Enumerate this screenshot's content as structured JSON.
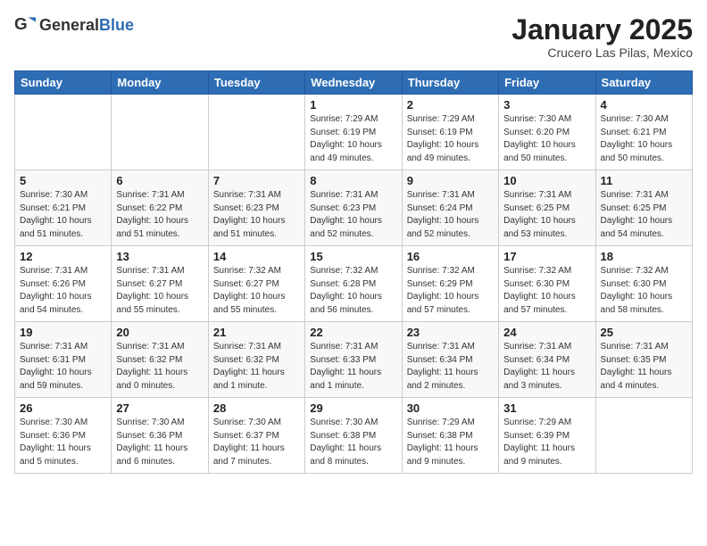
{
  "header": {
    "logo_general": "General",
    "logo_blue": "Blue",
    "month_year": "January 2025",
    "location": "Crucero Las Pilas, Mexico"
  },
  "weekdays": [
    "Sunday",
    "Monday",
    "Tuesday",
    "Wednesday",
    "Thursday",
    "Friday",
    "Saturday"
  ],
  "weeks": [
    [
      {
        "day": "",
        "content": ""
      },
      {
        "day": "",
        "content": ""
      },
      {
        "day": "",
        "content": ""
      },
      {
        "day": "1",
        "content": "Sunrise: 7:29 AM\nSunset: 6:19 PM\nDaylight: 10 hours\nand 49 minutes."
      },
      {
        "day": "2",
        "content": "Sunrise: 7:29 AM\nSunset: 6:19 PM\nDaylight: 10 hours\nand 49 minutes."
      },
      {
        "day": "3",
        "content": "Sunrise: 7:30 AM\nSunset: 6:20 PM\nDaylight: 10 hours\nand 50 minutes."
      },
      {
        "day": "4",
        "content": "Sunrise: 7:30 AM\nSunset: 6:21 PM\nDaylight: 10 hours\nand 50 minutes."
      }
    ],
    [
      {
        "day": "5",
        "content": "Sunrise: 7:30 AM\nSunset: 6:21 PM\nDaylight: 10 hours\nand 51 minutes."
      },
      {
        "day": "6",
        "content": "Sunrise: 7:31 AM\nSunset: 6:22 PM\nDaylight: 10 hours\nand 51 minutes."
      },
      {
        "day": "7",
        "content": "Sunrise: 7:31 AM\nSunset: 6:23 PM\nDaylight: 10 hours\nand 51 minutes."
      },
      {
        "day": "8",
        "content": "Sunrise: 7:31 AM\nSunset: 6:23 PM\nDaylight: 10 hours\nand 52 minutes."
      },
      {
        "day": "9",
        "content": "Sunrise: 7:31 AM\nSunset: 6:24 PM\nDaylight: 10 hours\nand 52 minutes."
      },
      {
        "day": "10",
        "content": "Sunrise: 7:31 AM\nSunset: 6:25 PM\nDaylight: 10 hours\nand 53 minutes."
      },
      {
        "day": "11",
        "content": "Sunrise: 7:31 AM\nSunset: 6:25 PM\nDaylight: 10 hours\nand 54 minutes."
      }
    ],
    [
      {
        "day": "12",
        "content": "Sunrise: 7:31 AM\nSunset: 6:26 PM\nDaylight: 10 hours\nand 54 minutes."
      },
      {
        "day": "13",
        "content": "Sunrise: 7:31 AM\nSunset: 6:27 PM\nDaylight: 10 hours\nand 55 minutes."
      },
      {
        "day": "14",
        "content": "Sunrise: 7:32 AM\nSunset: 6:27 PM\nDaylight: 10 hours\nand 55 minutes."
      },
      {
        "day": "15",
        "content": "Sunrise: 7:32 AM\nSunset: 6:28 PM\nDaylight: 10 hours\nand 56 minutes."
      },
      {
        "day": "16",
        "content": "Sunrise: 7:32 AM\nSunset: 6:29 PM\nDaylight: 10 hours\nand 57 minutes."
      },
      {
        "day": "17",
        "content": "Sunrise: 7:32 AM\nSunset: 6:30 PM\nDaylight: 10 hours\nand 57 minutes."
      },
      {
        "day": "18",
        "content": "Sunrise: 7:32 AM\nSunset: 6:30 PM\nDaylight: 10 hours\nand 58 minutes."
      }
    ],
    [
      {
        "day": "19",
        "content": "Sunrise: 7:31 AM\nSunset: 6:31 PM\nDaylight: 10 hours\nand 59 minutes."
      },
      {
        "day": "20",
        "content": "Sunrise: 7:31 AM\nSunset: 6:32 PM\nDaylight: 11 hours\nand 0 minutes."
      },
      {
        "day": "21",
        "content": "Sunrise: 7:31 AM\nSunset: 6:32 PM\nDaylight: 11 hours\nand 1 minute."
      },
      {
        "day": "22",
        "content": "Sunrise: 7:31 AM\nSunset: 6:33 PM\nDaylight: 11 hours\nand 1 minute."
      },
      {
        "day": "23",
        "content": "Sunrise: 7:31 AM\nSunset: 6:34 PM\nDaylight: 11 hours\nand 2 minutes."
      },
      {
        "day": "24",
        "content": "Sunrise: 7:31 AM\nSunset: 6:34 PM\nDaylight: 11 hours\nand 3 minutes."
      },
      {
        "day": "25",
        "content": "Sunrise: 7:31 AM\nSunset: 6:35 PM\nDaylight: 11 hours\nand 4 minutes."
      }
    ],
    [
      {
        "day": "26",
        "content": "Sunrise: 7:30 AM\nSunset: 6:36 PM\nDaylight: 11 hours\nand 5 minutes."
      },
      {
        "day": "27",
        "content": "Sunrise: 7:30 AM\nSunset: 6:36 PM\nDaylight: 11 hours\nand 6 minutes."
      },
      {
        "day": "28",
        "content": "Sunrise: 7:30 AM\nSunset: 6:37 PM\nDaylight: 11 hours\nand 7 minutes."
      },
      {
        "day": "29",
        "content": "Sunrise: 7:30 AM\nSunset: 6:38 PM\nDaylight: 11 hours\nand 8 minutes."
      },
      {
        "day": "30",
        "content": "Sunrise: 7:29 AM\nSunset: 6:38 PM\nDaylight: 11 hours\nand 9 minutes."
      },
      {
        "day": "31",
        "content": "Sunrise: 7:29 AM\nSunset: 6:39 PM\nDaylight: 11 hours\nand 9 minutes."
      },
      {
        "day": "",
        "content": ""
      }
    ]
  ]
}
